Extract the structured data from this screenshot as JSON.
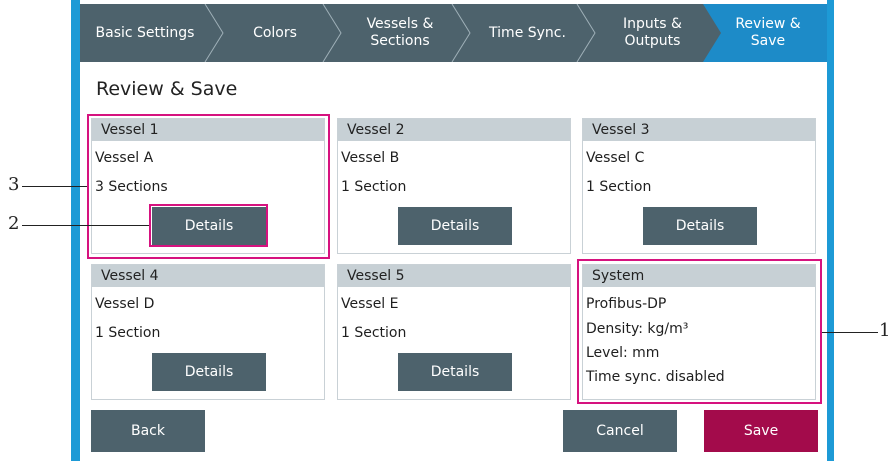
{
  "wizard": {
    "tabs": [
      {
        "label": "Basic Settings"
      },
      {
        "label": "Colors"
      },
      {
        "label": "Vessels &\nSections"
      },
      {
        "label": "Time Sync."
      },
      {
        "label": "Inputs &\nOutputs"
      },
      {
        "label": "Review &\nSave",
        "active": true
      }
    ]
  },
  "page": {
    "title": "Review & Save"
  },
  "vessels": [
    {
      "header": "Vessel 1",
      "name": "Vessel A",
      "sections": "3 Sections",
      "button": "Details"
    },
    {
      "header": "Vessel 2",
      "name": "Vessel B",
      "sections": "1 Section",
      "button": "Details"
    },
    {
      "header": "Vessel 3",
      "name": "Vessel C",
      "sections": "1 Section",
      "button": "Details"
    },
    {
      "header": "Vessel 4",
      "name": "Vessel D",
      "sections": "1 Section",
      "button": "Details"
    },
    {
      "header": "Vessel 5",
      "name": "Vessel E",
      "sections": "1 Section",
      "button": "Details"
    }
  ],
  "system": {
    "header": "System",
    "lines": [
      "Profibus-DP",
      "Density: kg/m³",
      "Level: mm",
      "Time sync. disabled"
    ]
  },
  "footer": {
    "back": "Back",
    "cancel": "Cancel",
    "save": "Save"
  },
  "callouts": [
    "1",
    "2",
    "3"
  ],
  "colors": {
    "accent_blue": "#1d9ad6",
    "nav_bg": "#4d626c",
    "active_tab": "#1d8bc8",
    "highlight": "#d6127f",
    "save": "#a30b4b"
  }
}
